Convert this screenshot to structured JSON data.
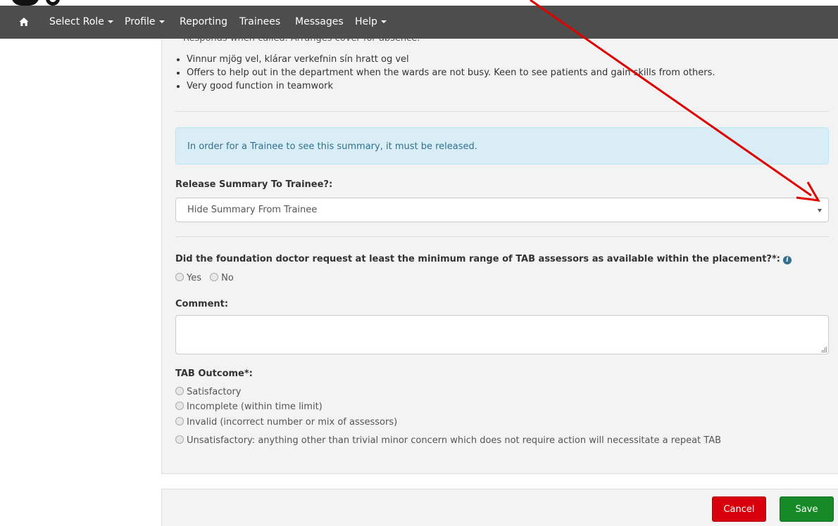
{
  "navbar": {
    "items": [
      {
        "label": "Select Role",
        "dropdown": true
      },
      {
        "label": "Profile",
        "dropdown": true
      },
      {
        "label": "Reporting",
        "dropdown": false
      },
      {
        "label": "Trainees",
        "dropdown": false
      },
      {
        "label": "Messages",
        "dropdown": false
      },
      {
        "label": "Help",
        "dropdown": true
      }
    ],
    "home_icon": "home-icon",
    "background": "#4d4d4d"
  },
  "feedback": {
    "cut_line": "Responds when called. Arranges cover for absence.",
    "bullets": [
      "Vinnur mjög vel, klárar verkefnin sín hratt og vel",
      "Offers to help out in the department when the wards are not busy. Keen to see patients and gain skills from others.",
      "Very good function in teamwork"
    ]
  },
  "alert": {
    "text": "In order for a Trainee to see this summary, it must be released.",
    "color": "#d9edf7"
  },
  "release": {
    "label": "Release Summary To Trainee?:",
    "selected": "Hide Summary From Trainee"
  },
  "tab_question": {
    "label": "Did the foundation doctor request at least the minimum range of TAB assessors as available within the placement?*:",
    "icon": "info-icon",
    "options": [
      "Yes",
      "No"
    ]
  },
  "comment": {
    "label": "Comment:",
    "value": ""
  },
  "outcome": {
    "label": "TAB Outcome*:",
    "options": [
      "Satisfactory",
      "Incomplete (within time limit)",
      "Invalid (incorrect number or mix of assessors)",
      "Unsatisfactory: anything other than trivial minor concern which does not require action will necessitate a repeat TAB"
    ]
  },
  "footer": {
    "cancel_label": "Cancel",
    "save_label": "Save",
    "cancel_color": "#d9000d",
    "save_color": "#158a26"
  },
  "annotation": {
    "arrow_color": "#e00000"
  }
}
